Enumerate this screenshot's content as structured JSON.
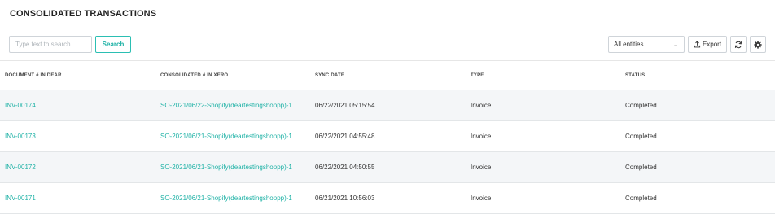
{
  "page": {
    "title": "CONSOLIDATED TRANSACTIONS"
  },
  "toolbar": {
    "search_placeholder": "Type text to search",
    "search_label": "Search",
    "entity_filter": "All entities",
    "export_label": "Export"
  },
  "table": {
    "columns": [
      "DOCUMENT # IN DEAR",
      "CONSOLIDATED # IN XERO",
      "SYNC DATE",
      "TYPE",
      "STATUS"
    ],
    "rows": [
      {
        "document": "INV-00174",
        "consolidated": "SO-2021/06/22-Shopify(deartestingshoppp)-1",
        "sync_date": "06/22/2021 05:15:54",
        "type": "Invoice",
        "status": "Completed"
      },
      {
        "document": "INV-00173",
        "consolidated": "SO-2021/06/21-Shopify(deartestingshoppp)-1",
        "sync_date": "06/22/2021 04:55:48",
        "type": "Invoice",
        "status": "Completed"
      },
      {
        "document": "INV-00172",
        "consolidated": "SO-2021/06/21-Shopify(deartestingshoppp)-1",
        "sync_date": "06/22/2021 04:50:55",
        "type": "Invoice",
        "status": "Completed"
      },
      {
        "document": "INV-00171",
        "consolidated": "SO-2021/06/21-Shopify(deartestingshoppp)-1",
        "sync_date": "06/21/2021 10:56:03",
        "type": "Invoice",
        "status": "Completed"
      }
    ]
  },
  "icons": {
    "export": "upload-icon",
    "refresh": "refresh-icon",
    "settings": "gear-icon",
    "dropdown": "chevron-down-icon"
  },
  "colors": {
    "accent": "#1fb2a6",
    "row_alt": "#f4f6f8",
    "border": "#cfd4d9"
  }
}
